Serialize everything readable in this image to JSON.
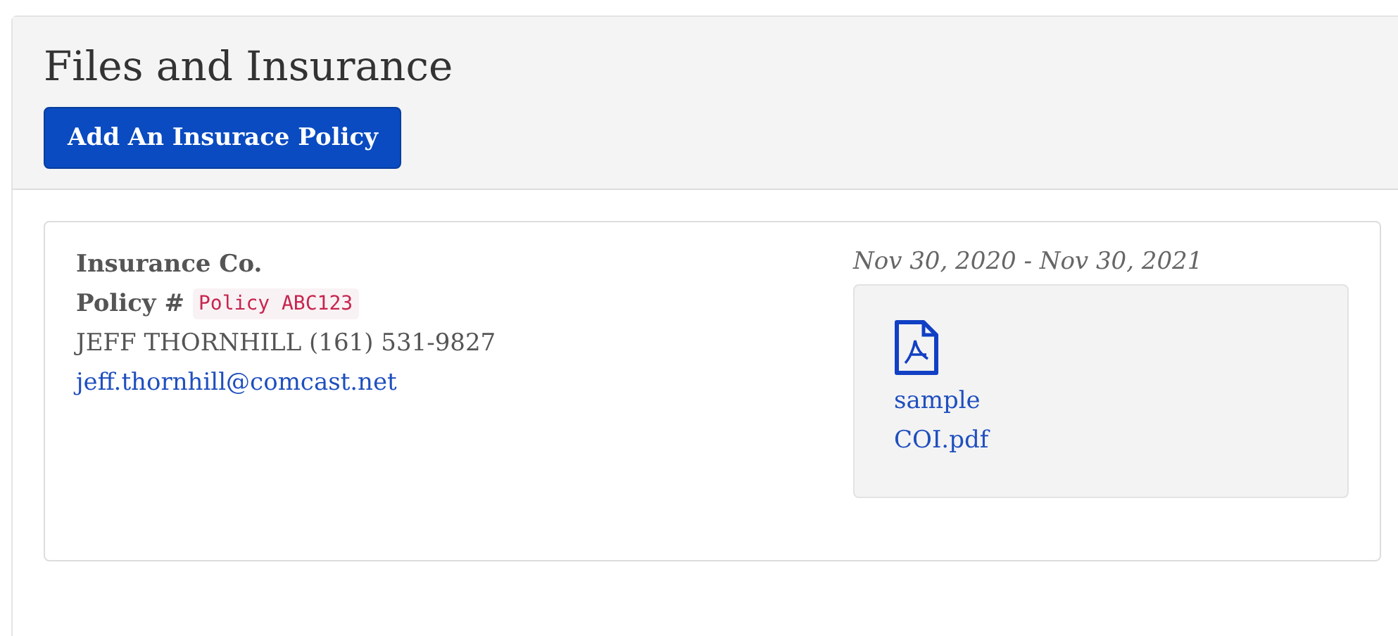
{
  "header": {
    "title": "Files and Insurance",
    "add_button": "Add An Insurace Policy"
  },
  "policies": [
    {
      "company": "Insurance Co.",
      "policy_label": "Policy #",
      "policy_number": "Policy ABC123",
      "contact": "JEFF THORNHILL (161) 531-9827",
      "email": "jeff.thornhill@comcast.net",
      "dates": "Nov 30, 2020 - Nov 30, 2021",
      "files": [
        {
          "name": "sample COI.pdf"
        }
      ]
    }
  ]
}
